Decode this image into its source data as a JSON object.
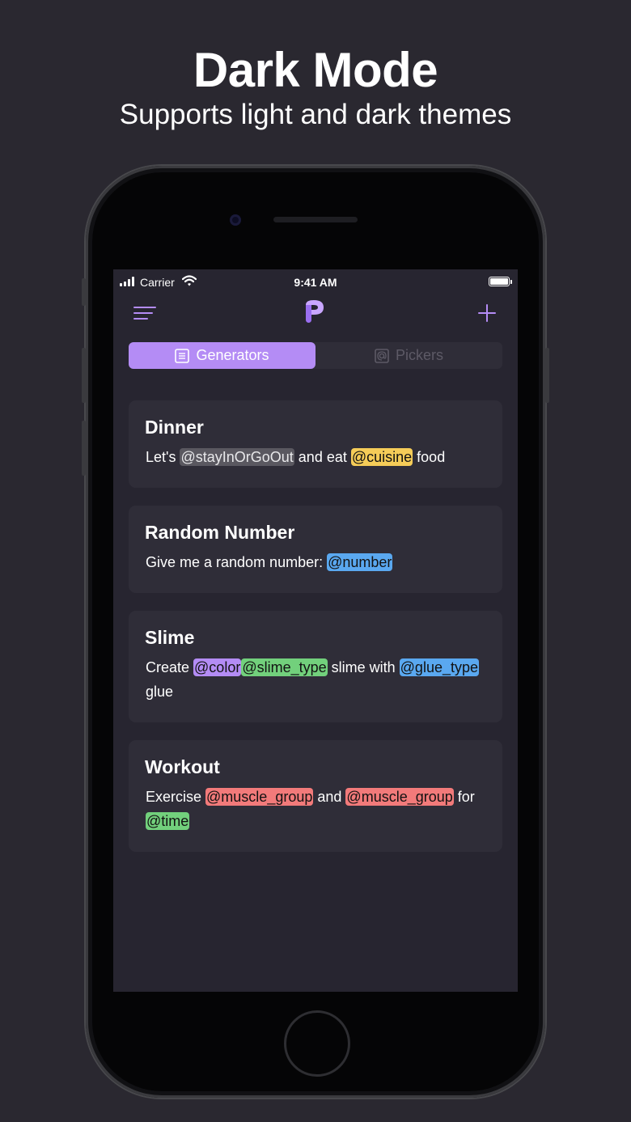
{
  "headline": "Dark Mode",
  "subheadline": "Supports light and dark themes",
  "status_bar": {
    "carrier": "Carrier",
    "time": "9:41 AM"
  },
  "nav": {
    "menu_icon": "menu-icon",
    "logo_icon": "p-logo-icon",
    "add_icon": "plus-icon"
  },
  "tabs": [
    {
      "label": "Generators",
      "icon": "list-icon",
      "active": true
    },
    {
      "label": "Pickers",
      "icon": "at-icon",
      "active": false
    }
  ],
  "cards": [
    {
      "title": "Dinner",
      "body": [
        {
          "text": "Let's "
        },
        {
          "tag": "@stayInOrGoOut",
          "color": "gray"
        },
        {
          "text": " and eat "
        },
        {
          "tag": "@cuisine",
          "color": "yellow"
        },
        {
          "text": " food"
        }
      ]
    },
    {
      "title": "Random Number",
      "body": [
        {
          "text": "Give me a random number: "
        },
        {
          "tag": "@number",
          "color": "blue"
        }
      ]
    },
    {
      "title": "Slime",
      "body": [
        {
          "text": "Create "
        },
        {
          "tag": "@color",
          "color": "purple"
        },
        {
          "tag": "@slime_type",
          "color": "green"
        },
        {
          "text": " slime with "
        },
        {
          "tag": "@glue_type",
          "color": "blue"
        },
        {
          "text": " glue"
        }
      ]
    },
    {
      "title": "Workout",
      "body": [
        {
          "text": "Exercise "
        },
        {
          "tag": "@muscle_group",
          "color": "red"
        },
        {
          "text": " and "
        },
        {
          "tag": "@muscle_group",
          "color": "red"
        },
        {
          "text": " for "
        },
        {
          "tag": "@time",
          "color": "green"
        }
      ]
    }
  ],
  "colors": {
    "accent": "#b48cf5",
    "background": "#2a2830",
    "card": "#2f2d38",
    "tag_gray": "#5a5860",
    "tag_yellow": "#f5cc58",
    "tag_blue": "#5aa8f0",
    "tag_purple": "#b48cf5",
    "tag_green": "#72d07c",
    "tag_red": "#f27a7a"
  }
}
